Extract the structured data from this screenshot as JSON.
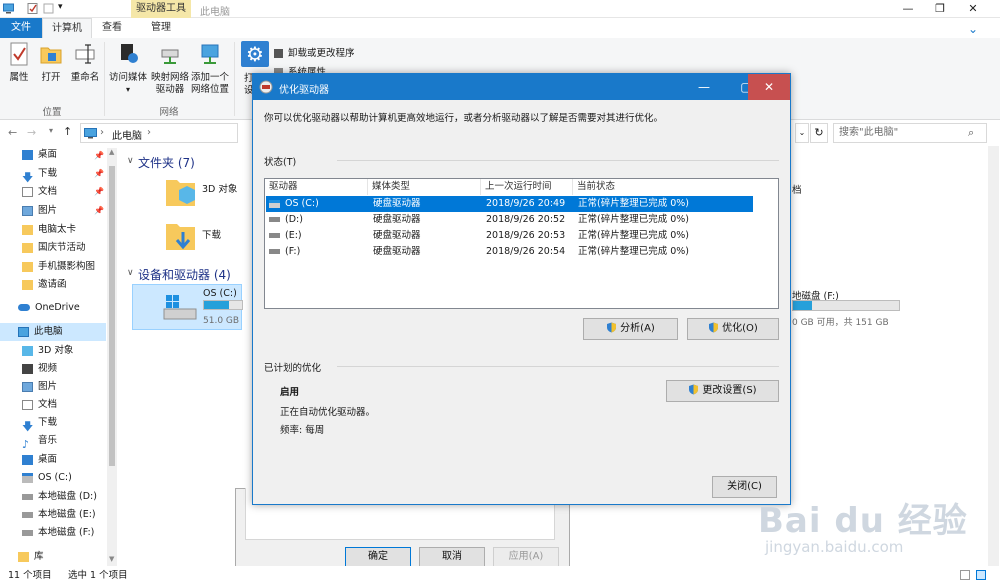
{
  "explorer": {
    "title": "此电脑",
    "context_tab": "驱动器工具",
    "tabs": [
      "文件",
      "计算机",
      "查看",
      "管理"
    ],
    "ribbon": {
      "location": {
        "buttons": [
          "属性",
          "打开",
          "重命名"
        ],
        "label": "位置"
      },
      "network": {
        "buttons": [
          {
            "line1": "访问媒体",
            "line2": ""
          },
          {
            "line1": "映射网络",
            "line2": "驱动器"
          },
          {
            "line1": "添加一个",
            "line2": "网络位置"
          }
        ],
        "label": "网络"
      },
      "system": {
        "items": [
          "卸载或更改程序",
          "系统属性"
        ],
        "clipped_left": [
          "打",
          "设"
        ]
      }
    },
    "address": {
      "path": "此电脑",
      "separator": "›"
    },
    "search_placeholder": "搜索\"此电脑\"",
    "nav": {
      "quick": [
        "桌面",
        "下载",
        "文档",
        "图片",
        "电脑太卡",
        "国庆节活动",
        "手机摄影构图",
        "邀请函"
      ],
      "onedrive": "OneDrive",
      "this_pc": "此电脑",
      "pc_items": [
        "3D 对象",
        "视频",
        "图片",
        "文档",
        "下载",
        "音乐",
        "桌面",
        "OS (C:)",
        "本地磁盘 (D:)",
        "本地磁盘 (E:)",
        "本地磁盘 (F:)"
      ],
      "library": "库"
    },
    "content": {
      "folders_header": "文件夹 (7)",
      "folder_items": [
        "3D 对象",
        "下载"
      ],
      "devices_header": "设备和驱动器 (4)",
      "drive_os": {
        "name": "OS (C:)",
        "free": "51.0 GB",
        "usage_pct": 65
      },
      "right_partial": {
        "title_clip": "档",
        "drive_f_name": "地磁盘 (F:)",
        "drive_f_free": "0 GB 可用，共 151 GB",
        "usage_pct": 18
      }
    },
    "status": {
      "count": "11 个项目",
      "selected": "选中 1 个项目"
    }
  },
  "bg_dialog": {
    "ok": "确定",
    "cancel": "取消",
    "apply": "应用(A)"
  },
  "dialog": {
    "title": "优化驱动器",
    "description": "你可以优化驱动器以帮助计算机更高效地运行，或者分析驱动器以了解是否需要对其进行优化。",
    "status_label": "状态(T)",
    "columns": [
      "驱动器",
      "媒体类型",
      "上一次运行时间",
      "当前状态"
    ],
    "rows": [
      {
        "drive": "OS (C:)",
        "media": "硬盘驱动器",
        "last_run": "2018/9/26 20:49",
        "status": "正常(碎片整理已完成 0%)"
      },
      {
        "drive": "(D:)",
        "media": "硬盘驱动器",
        "last_run": "2018/9/26 20:52",
        "status": "正常(碎片整理已完成 0%)"
      },
      {
        "drive": "(E:)",
        "media": "硬盘驱动器",
        "last_run": "2018/9/26 20:53",
        "status": "正常(碎片整理已完成 0%)"
      },
      {
        "drive": "(F:)",
        "media": "硬盘驱动器",
        "last_run": "2018/9/26 20:54",
        "status": "正常(碎片整理已完成 0%)"
      }
    ],
    "analyze_button": "分析(A)",
    "optimize_button": "优化(O)",
    "scheduled_label": "已计划的优化",
    "schedule_state": "启用",
    "schedule_desc": "正在自动优化驱动器。",
    "frequency": "频率: 每周",
    "change_settings_button": "更改设置(S)",
    "close_button": "关闭(C)"
  },
  "watermark": {
    "brand": "Bai du 经验",
    "url": "jingyan.baidu.com"
  },
  "colors": {
    "accent": "#1979ca",
    "selection": "#0078d7",
    "context_tab": "#f5e7a8",
    "drive_bar": "#26a0da",
    "section_header": "#1e3287"
  }
}
